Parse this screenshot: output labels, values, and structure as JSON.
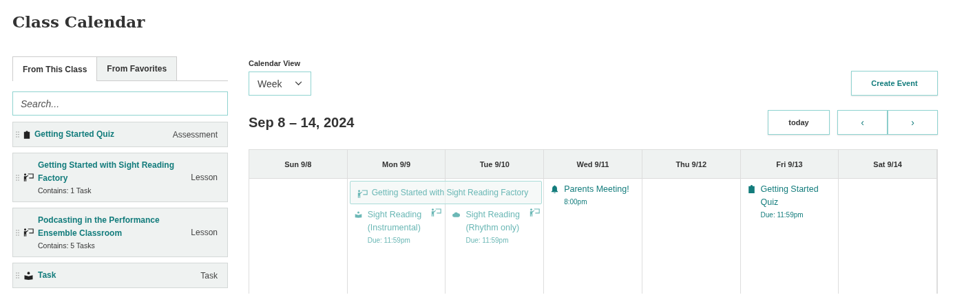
{
  "page_title": "Class Calendar",
  "tabs": [
    {
      "label": "From This Class",
      "selected": true
    },
    {
      "label": "From Favorites",
      "selected": false
    }
  ],
  "search": {
    "placeholder": "Search..."
  },
  "library_items": [
    {
      "kind": "assessment",
      "title": "Getting Started Quiz",
      "type": "Assessment"
    },
    {
      "kind": "lesson",
      "title": "Getting Started with Sight Reading Factory",
      "contains": "Contains: 1 Task",
      "type": "Lesson"
    },
    {
      "kind": "lesson",
      "title": "Podcasting in the Performance Ensemble Classroom",
      "contains": "Contains: 5 Tasks",
      "type": "Lesson"
    },
    {
      "kind": "task",
      "title": "Task",
      "type": "Task"
    }
  ],
  "calendar_view": {
    "label": "Calendar View",
    "value": "Week"
  },
  "create_event": "Create Event",
  "date_range": "Sep 8 – 14, 2024",
  "today": "today",
  "prev": "‹",
  "next": "›",
  "days": [
    {
      "label": "Sun 9/8"
    },
    {
      "label": "Mon 9/9",
      "events": [
        {
          "kind": "lesson",
          "title": "Getting Started with Sight Reading Factory",
          "spans_next_day": true,
          "dimmed": true
        },
        {
          "kind": "task",
          "title": "Sight Reading (Instrumental)",
          "due": "Due: 11:59pm",
          "in_lesson": true,
          "dimmed": true
        }
      ]
    },
    {
      "label": "Tue 9/10",
      "events": [
        {
          "kind": "cloud",
          "title": "Sight Reading (Rhythm only)",
          "due": "Due: 11:59pm",
          "in_lesson": true,
          "dimmed": true
        }
      ]
    },
    {
      "label": "Wed 9/11",
      "events": [
        {
          "kind": "meeting",
          "title": "Parents Meeting!",
          "due": "8:00pm",
          "in_lesson": false,
          "dimmed": false
        }
      ]
    },
    {
      "label": "Thu 9/12"
    },
    {
      "label": "Fri 9/13",
      "events": [
        {
          "kind": "assessment",
          "title": "Getting Started Quiz",
          "due": "Due: 11:59pm",
          "in_lesson": false,
          "dimmed": false
        }
      ]
    },
    {
      "label": "Sat 9/14"
    }
  ]
}
